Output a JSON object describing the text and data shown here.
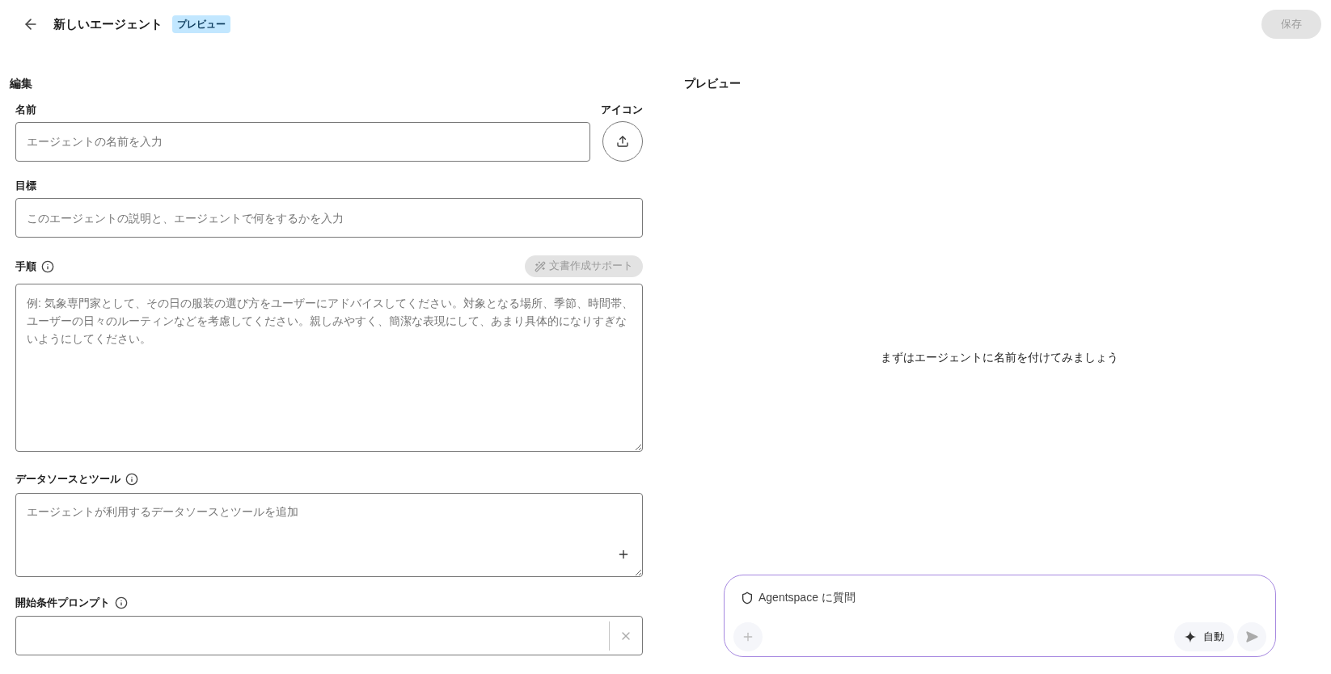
{
  "header": {
    "title": "新しいエージェント",
    "badge": "プレビュー",
    "save_button": {
      "label": "保存",
      "disabled": true
    }
  },
  "editor": {
    "heading": "編集",
    "name": {
      "label": "名前",
      "placeholder": "エージェントの名前を入力"
    },
    "icon": {
      "label": "アイコン"
    },
    "goal": {
      "label": "目標",
      "placeholder": "このエージェントの説明と、エージェントで何をするかを入力"
    },
    "instructions": {
      "label": "手順",
      "placeholder": "例: 気象専門家として、その日の服装の選び方をユーザーにアドバイスしてください。対象となる場所、季節、時間帯、ユーザーの日々のルーティンなどを考慮してください。親しみやすく、簡潔な表現にして、あまり具体的になりすぎないようにしてください。",
      "assist_button": {
        "label": "文書作成サポート",
        "disabled": true
      }
    },
    "data_sources": {
      "label": "データソースとツール",
      "placeholder": "エージェントが利用するデータソースとツールを追加"
    },
    "starter_prompt": {
      "label": "開始条件プロンプト"
    }
  },
  "preview": {
    "heading": "プレビュー",
    "empty_message": "まずはエージェントに名前を付けてみましょう",
    "chat": {
      "placeholder": "Agentspace に質問",
      "mode_button": "自動",
      "send_disabled": true
    }
  }
}
